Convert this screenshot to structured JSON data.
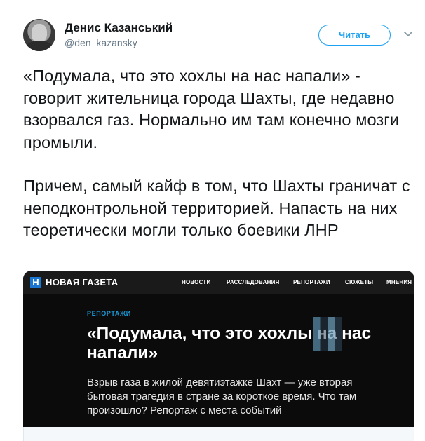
{
  "author": {
    "name": "Денис Казанський",
    "handle": "@den_kazansky"
  },
  "follow_label": "Читать",
  "icons": {
    "menu": "chevron-down-icon",
    "avatar": "profile-photo"
  },
  "tweet": {
    "paragraph1": "«Подумала, что это хохлы на нас напали» - говорит жительница города Шахты, где недавно взорвался газ. Нормально им там конечно мозги промыли.",
    "paragraph2": "Причем, самый кайф в том, что Шахты граничат с неподконтрольной территорией. Напасть на них теоретически могли только боевики ЛНР"
  },
  "card": {
    "logo_letter": "Н",
    "logo_text": "НОВАЯ ГАЗЕТА",
    "nav": [
      "НОВОСТИ",
      "РАССЛЕДОВАНИЯ",
      "РЕПОРТАЖИ",
      "СЮЖЕТЫ",
      "МНЕНИЯ"
    ],
    "section": "РЕПОРТАЖИ",
    "title": "«Подумала, что это хохлы на нас напали»",
    "description": "Взрыв газа в жилой девятиэтажке Шахт — уже вторая бытовая трагедия в стране за короткое время. Что там произошло? Репортаж с места событий"
  },
  "colors": {
    "accent": "#1da1f2",
    "card_background": "#0d0d0d",
    "section_label": "#1b9ad6",
    "logo_blue": "#1b76d2"
  }
}
